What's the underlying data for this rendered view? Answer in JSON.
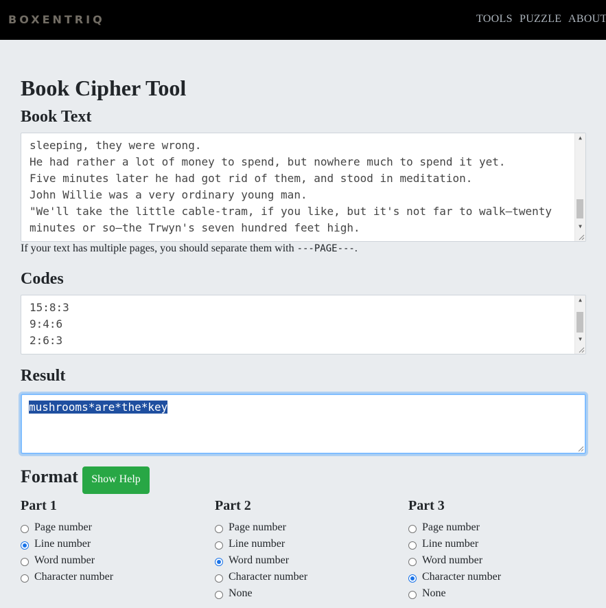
{
  "nav": {
    "brand": "BOXENTRIQ",
    "links": [
      "TOOLS",
      "PUZZLE",
      "ABOUT"
    ]
  },
  "page_title": "Book Cipher Tool",
  "book_text": {
    "heading": "Book Text",
    "lines": [
      "sleeping, they were wrong.",
      "He had rather a lot of money to spend, but nowhere much to spend it yet.",
      "Five minutes later he had got rid of them, and stood in meditation.",
      "John Willie was a very ordinary young man.",
      "\"We'll take the little cable-tram, if you like, but it's not far to walk—twenty",
      "minutes or so—the Trwyn's seven hundred feet high."
    ],
    "hint_prefix": "If your text has multiple pages, you should separate them with ",
    "hint_code": "---PAGE---",
    "hint_suffix": "."
  },
  "codes": {
    "heading": "Codes",
    "lines": [
      "15:8:3",
      "9:4:6",
      "2:6:3"
    ]
  },
  "result": {
    "heading": "Result",
    "value": "mushrooms*are*the*key"
  },
  "format": {
    "heading": "Format",
    "help_button": "Show Help",
    "parts": [
      {
        "title": "Part 1",
        "options": [
          "Page number",
          "Line number",
          "Word number",
          "Character number"
        ],
        "selected": "Line number"
      },
      {
        "title": "Part 2",
        "options": [
          "Page number",
          "Line number",
          "Word number",
          "Character number",
          "None"
        ],
        "selected": "Word number"
      },
      {
        "title": "Part 3",
        "options": [
          "Page number",
          "Line number",
          "Word number",
          "Character number",
          "None"
        ],
        "selected": "Character number"
      }
    ]
  },
  "colors": {
    "navbar": "#000000",
    "page_bg": "#e9ecef",
    "help_button": "#28a745",
    "focus_ring": "#80bdff",
    "selection": "#1f4fa0"
  }
}
